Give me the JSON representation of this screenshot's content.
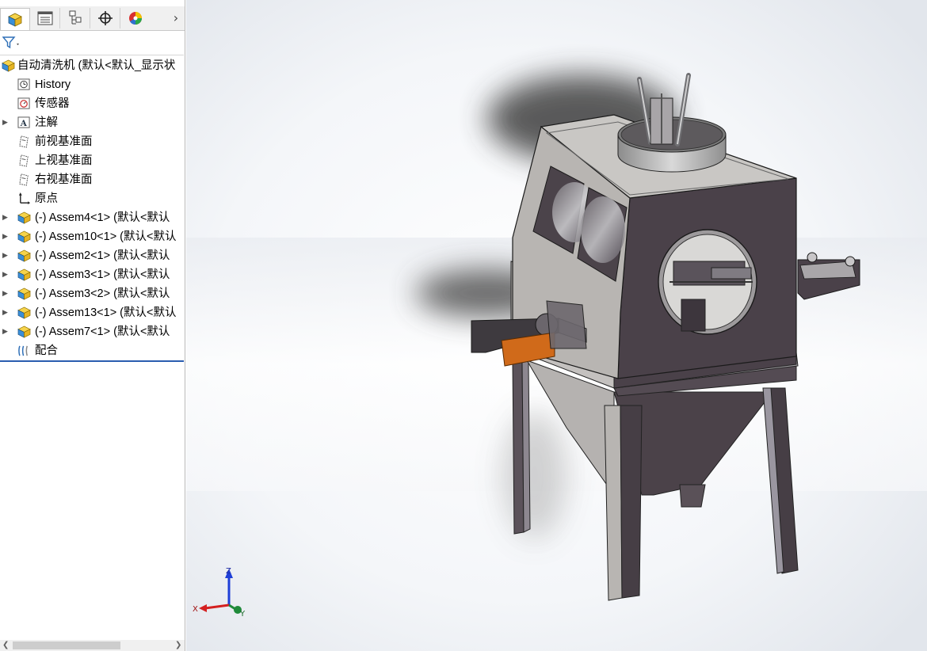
{
  "feature_tree": {
    "tabs": [
      "feature-manager",
      "property-manager",
      "configuration-manager",
      "dimxpert-manager",
      "display-manager"
    ],
    "root": {
      "label": "自动清洗机  (默认<默认_显示状"
    },
    "items": [
      {
        "label": "History",
        "icon": "history-icon",
        "expandable": false
      },
      {
        "label": "传感器",
        "icon": "sensor-icon",
        "expandable": false
      },
      {
        "label": "注解",
        "icon": "annotation-icon",
        "expandable": true
      },
      {
        "label": "前视基准面",
        "icon": "plane-icon",
        "expandable": false
      },
      {
        "label": "上视基准面",
        "icon": "plane-icon",
        "expandable": false
      },
      {
        "label": "右视基准面",
        "icon": "plane-icon",
        "expandable": false
      },
      {
        "label": "原点",
        "icon": "origin-icon",
        "expandable": false
      },
      {
        "label": "(-) Assem4<1> (默认<默认",
        "icon": "subassembly-icon",
        "expandable": true
      },
      {
        "label": "(-) Assem10<1> (默认<默认",
        "icon": "subassembly-icon",
        "expandable": true
      },
      {
        "label": "(-) Assem2<1> (默认<默认",
        "icon": "subassembly-icon",
        "expandable": true
      },
      {
        "label": "(-) Assem3<1> (默认<默认",
        "icon": "subassembly-icon",
        "expandable": true
      },
      {
        "label": "(-) Assem3<2> (默认<默认",
        "icon": "subassembly-icon",
        "expandable": true
      },
      {
        "label": "(-) Assem13<1> (默认<默认",
        "icon": "subassembly-icon",
        "expandable": true
      },
      {
        "label": "(-) Assem7<1> (默认<默认",
        "icon": "subassembly-icon",
        "expandable": true
      },
      {
        "label": "配合",
        "icon": "mates-icon",
        "expandable": false
      }
    ]
  },
  "triad": {
    "x": "X",
    "y": "Y",
    "z": "Z"
  },
  "colors": {
    "accent": "#2a5db0",
    "frame": "#4a4149",
    "steel": "#b9b6b3",
    "orange": "#d06a1a"
  }
}
